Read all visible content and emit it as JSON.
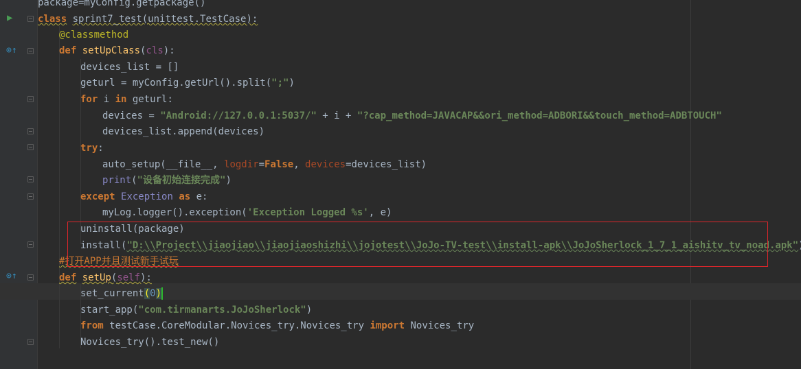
{
  "editor": {
    "lines": [
      "package=myConfig.getpackage()",
      "class sprint7_test(unittest.TestCase):",
      "@classmethod",
      "def setUpClass(cls):",
      "devices_list = []",
      "geturl = myConfig.getUrl().split(\";\")",
      "for i in geturl:",
      "devices = \"Android://127.0.0.1:5037/\" + i + \"?cap_method=JAVACAP&&ori_method=ADBORI&&touch_method=ADBTOUCH\"",
      "devices_list.append(devices)",
      "try:",
      "auto_setup(__file__, logdir=False, devices=devices_list)",
      "print(\"设备初始连接完成\")",
      "except Exception as e:",
      "myLog.logger().exception('Exception Logged %s', e)",
      "uninstall(package)",
      "install(\"D:\\\\Project\\\\jiaojiao\\\\jiaojiaoshizhi\\\\jojotest\\\\JoJo-TV-test\\\\install-apk\\\\JoJoSherlock_1_7_1_aishitv_tv_noad.apk\")",
      "#打开APP并且测试新手试玩",
      "def setUp(self):",
      "set_current(0)",
      "start_app(\"com.tirmanarts.JoJoSherlock\")",
      "from testCase.CoreModular.Novices_try.Novices_try import Novices_try",
      "Novices_try().test_new()"
    ]
  },
  "icons": {
    "run": "run-triangle-icon",
    "override": "override-method-icon",
    "fold": "fold-icon"
  },
  "colors": {
    "background": "#2b2b2b",
    "keyword": "#cc7832",
    "string": "#6a8759",
    "highlight_box": "#e0262b"
  }
}
